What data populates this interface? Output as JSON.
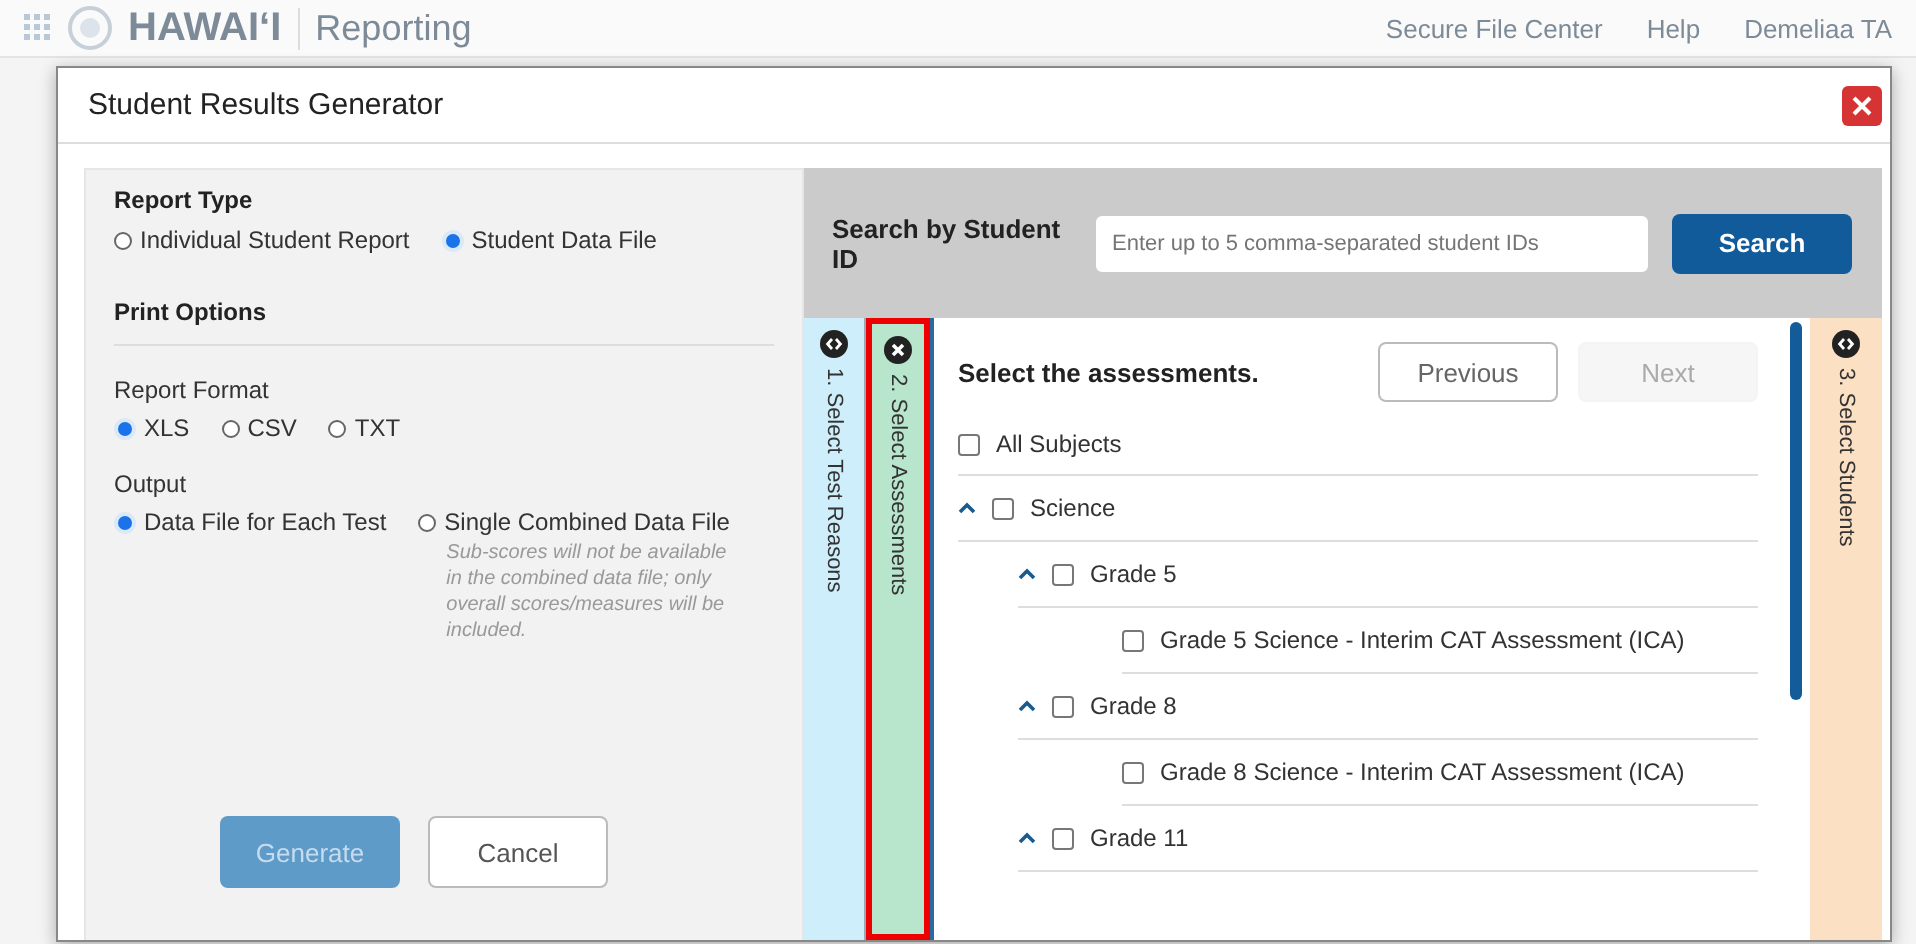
{
  "backdrop": {
    "logo": "HAWAIʻI",
    "product": "Reporting",
    "links": [
      "Secure File Center",
      "Help"
    ],
    "user": "Demeliaa TA"
  },
  "dialog": {
    "title": "Student Results Generator",
    "report_type": {
      "label": "Report Type",
      "options": [
        {
          "label": "Individual Student Report",
          "selected": false
        },
        {
          "label": "Student Data File",
          "selected": true
        }
      ]
    },
    "print_options": {
      "label": "Print Options",
      "format": {
        "label": "Report Format",
        "options": [
          {
            "label": "XLS",
            "selected": true
          },
          {
            "label": "CSV",
            "selected": false
          },
          {
            "label": "TXT",
            "selected": false
          }
        ]
      },
      "output": {
        "label": "Output",
        "options": [
          {
            "label": "Data File for Each Test",
            "selected": true
          },
          {
            "label": "Single Combined Data File",
            "selected": false,
            "note": "Sub-scores will not be available in the combined data file; only overall scores/measures will be included."
          }
        ]
      }
    },
    "buttons": [
      {
        "label": "Generate",
        "disabled": true
      },
      {
        "label": "Cancel",
        "disabled": false
      }
    ],
    "search": {
      "label": "Search by Student ID",
      "placeholder": "Enter up to 5 comma-separated student IDs",
      "button": "Search"
    },
    "steps": [
      {
        "label": "1. Select Test Reasons",
        "selected": false,
        "color": "#cdeefa"
      },
      {
        "label": "2. Select Assessments",
        "selected": true,
        "color": "#b7e6cc"
      },
      {
        "label": "3. Select Students",
        "selected": false,
        "color": "#fbe0c4"
      }
    ],
    "assessments": {
      "heading": "Select the assessments.",
      "previous": {
        "label": "Previous",
        "disabled": false
      },
      "next": {
        "label": "Next",
        "disabled": true
      },
      "all": {
        "label": "All Subjects",
        "checked": false
      },
      "tree": [
        {
          "label": "Science",
          "checked": false,
          "expanded": true,
          "children": [
            {
              "label": "Grade 5",
              "checked": false,
              "expanded": true,
              "children": [
                {
                  "label": "Grade 5 Science - Interim CAT Assessment (ICA)",
                  "checked": false
                }
              ]
            },
            {
              "label": "Grade 8",
              "checked": false,
              "expanded": true,
              "children": [
                {
                  "label": "Grade 8 Science - Interim CAT Assessment (ICA)",
                  "checked": false
                }
              ]
            },
            {
              "label": "Grade 11",
              "checked": false,
              "expanded": true
            }
          ]
        }
      ]
    }
  }
}
